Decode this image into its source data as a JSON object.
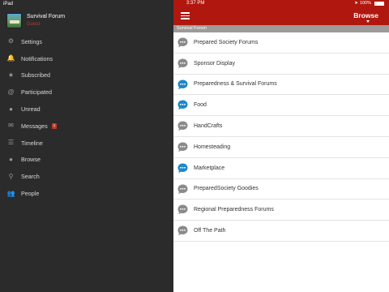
{
  "status_bar": {
    "device": "iPad",
    "time": "3:37 PM",
    "battery": "100%"
  },
  "sidebar": {
    "forum_title": "Survival Forum",
    "forum_subtitle": "Guest",
    "items": [
      {
        "label": "Settings",
        "icon": "gear-icon",
        "glyph": "⚙"
      },
      {
        "label": "Notifications",
        "icon": "bell-icon",
        "glyph": "🔔"
      },
      {
        "label": "Subscribed",
        "icon": "star-icon",
        "glyph": "★"
      },
      {
        "label": "Participated",
        "icon": "at-icon",
        "glyph": "@"
      },
      {
        "label": "Unread",
        "icon": "chat-icon",
        "glyph": "●"
      },
      {
        "label": "Messages",
        "icon": "envelope-icon",
        "glyph": "✉",
        "badge": "1"
      },
      {
        "label": "Timeline",
        "icon": "rss-icon",
        "glyph": "☰"
      },
      {
        "label": "Browse",
        "icon": "bubbles-icon",
        "glyph": "●"
      },
      {
        "label": "Search",
        "icon": "search-icon",
        "glyph": "⚲"
      },
      {
        "label": "People",
        "icon": "people-icon",
        "glyph": "👥"
      }
    ]
  },
  "header": {
    "title": "Browse"
  },
  "section_label": "Survival Forum",
  "forums": [
    {
      "label": "Prepared Society Forums",
      "icon_color": "#8a8a8a"
    },
    {
      "label": "Sponsor Display",
      "icon_color": "#8a8a8a"
    },
    {
      "label": "Preparedness & Survival Forums",
      "icon_color": "#1e88c8"
    },
    {
      "label": "Food",
      "icon_color": "#1e88c8"
    },
    {
      "label": "HandCrafts",
      "icon_color": "#8a8a8a"
    },
    {
      "label": "Homesteading",
      "icon_color": "#8a8a8a"
    },
    {
      "label": "Marketplace",
      "icon_color": "#1e88c8"
    },
    {
      "label": "PreparedSociety Goodies",
      "icon_color": "#8a8a8a"
    },
    {
      "label": "Regional Preparedness Forums",
      "icon_color": "#8a8a8a"
    },
    {
      "label": "Off The Path",
      "icon_color": "#8a8a8a"
    }
  ],
  "colors": {
    "accent": "#b0180f",
    "sidebar_bg": "#2b2b2b",
    "section_bg": "#9e9a99"
  }
}
